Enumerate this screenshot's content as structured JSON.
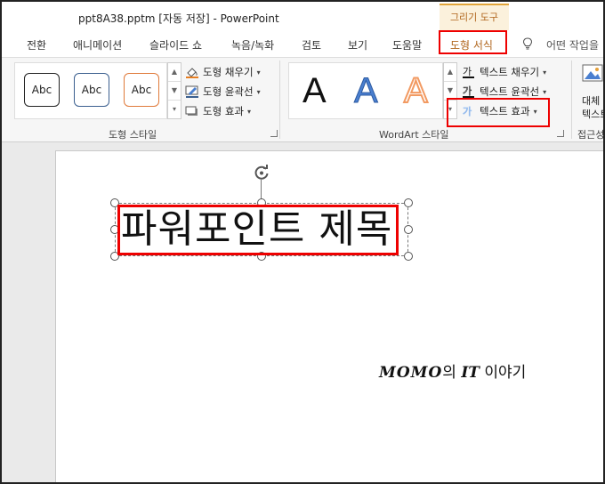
{
  "titlebar": {
    "doc_title": "ppt8A38.pptm [자동 저장]  -  PowerPoint",
    "context_group": "그리기 도구"
  },
  "tabs": [
    {
      "label": "전환"
    },
    {
      "label": "애니메이션"
    },
    {
      "label": "슬라이드 쇼"
    },
    {
      "label": "녹음/녹화"
    },
    {
      "label": "검토"
    },
    {
      "label": "보기"
    },
    {
      "label": "도움말"
    },
    {
      "label": "도형 서식",
      "active": true
    }
  ],
  "tell_me": "어떤 작업을",
  "ribbon": {
    "shape_styles": {
      "gallery": [
        "Abc",
        "Abc",
        "Abc"
      ],
      "commands": {
        "fill": "도형 채우기",
        "outline": "도형 윤곽선",
        "effects": "도형 효과"
      },
      "group_label": "도형 스타일"
    },
    "wordart": {
      "gallery": [
        "A",
        "A",
        "A"
      ],
      "commands": {
        "fill": "텍스트 채우기",
        "outline": "텍스트 윤곽선",
        "effects": "텍스트 효과"
      },
      "group_label": "WordArt 스타일",
      "effect_icon_glyph": "가"
    },
    "accessibility": {
      "alt_text": "대체",
      "alt_text_line2": "텍스트",
      "group_label": "접근성"
    }
  },
  "slide": {
    "title": "파워포인트 제목",
    "watermark_brand": "MOMO",
    "watermark_mid": "의 ",
    "watermark_it": "IT",
    "watermark_tail": " 이야기"
  },
  "colors": {
    "highlight": "#e00000",
    "context_accent": "#b0651c",
    "wordart_blue": "#4a7fd0",
    "wordart_orange": "#f29a62"
  }
}
